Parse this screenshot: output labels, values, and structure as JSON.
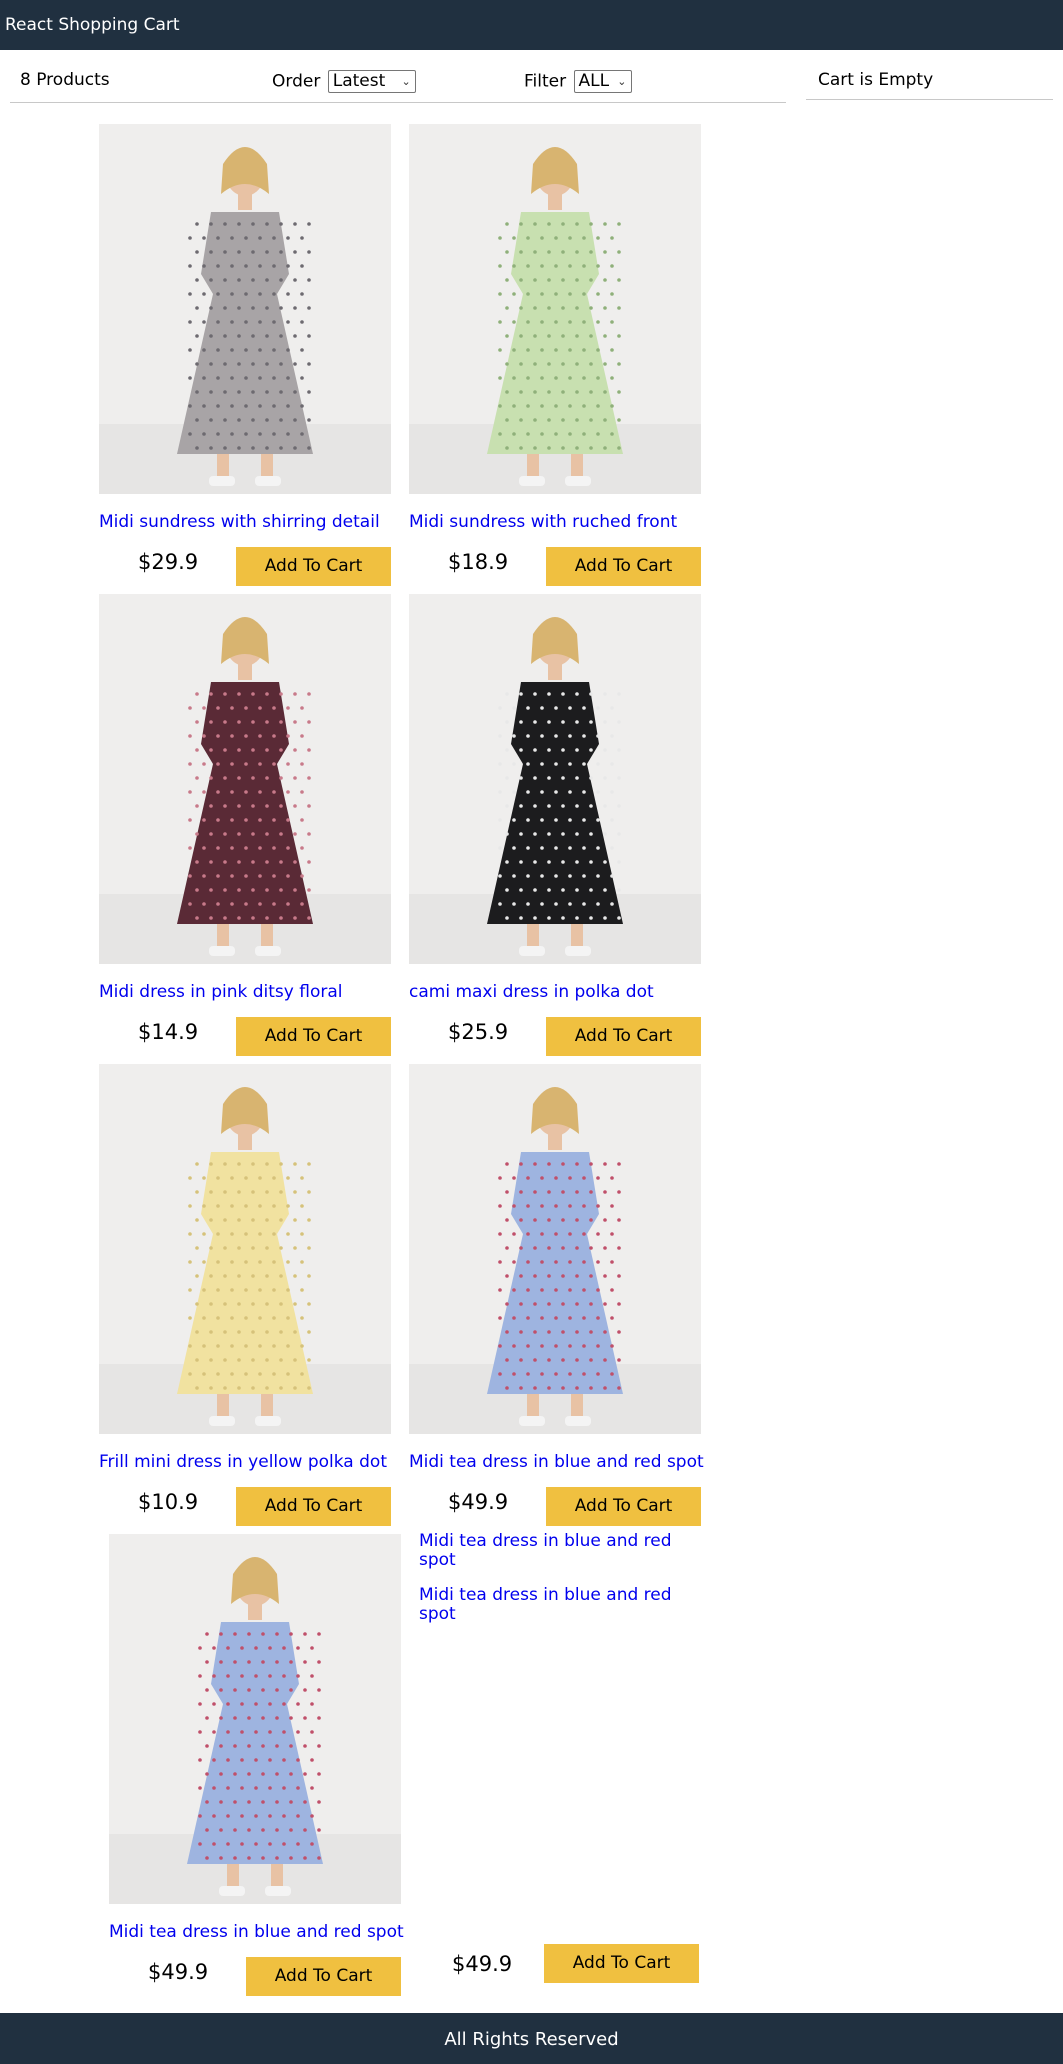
{
  "header": {
    "title": "React Shopping Cart"
  },
  "filter": {
    "count": "8 Products",
    "order_label": "Order",
    "order_value": "Latest",
    "filter_label": "Filter",
    "filter_value": "ALL"
  },
  "cart": {
    "empty_text": "Cart is Empty"
  },
  "products": [
    {
      "title": "Midi sundress with shirring detail",
      "price": "$29.9",
      "button": "Add To Cart",
      "dress_color": "#a8a4a6",
      "pattern": "#6d6a70"
    },
    {
      "title": "Midi sundress with ruched front",
      "price": "$18.9",
      "button": "Add To Cart",
      "dress_color": "#c8e0b0",
      "pattern": "#8fb07a"
    },
    {
      "title": "Midi dress in pink ditsy floral",
      "price": "$14.9",
      "button": "Add To Cart",
      "dress_color": "#5a2a36",
      "pattern": "#c87a8a"
    },
    {
      "title": "cami maxi dress in polka dot",
      "price": "$25.9",
      "button": "Add To Cart",
      "dress_color": "#1c1c1e",
      "pattern": "#e8e8e8"
    },
    {
      "title": "Frill mini dress in yellow polka dot",
      "price": "$10.9",
      "button": "Add To Cart",
      "dress_color": "#f1e2a0",
      "pattern": "#d6c27a"
    },
    {
      "title": "Midi tea dress in blue and red spot",
      "price": "$49.9",
      "button": "Add To Cart",
      "dress_color": "#9eb4e0",
      "pattern": "#c0506a"
    },
    {
      "title": "Midi tea dress in blue and red spot",
      "price": "$49.9",
      "button": "Add To Cart",
      "dress_color": "#9eb4e0",
      "pattern": "#c0506a"
    }
  ],
  "extra_links": [
    "Midi tea dress in blue and red spot",
    "Midi tea dress in blue and red spot"
  ],
  "extra_item": {
    "price": "$49.9",
    "button": "Add To Cart"
  },
  "footer": {
    "text": "All Rights Reserved"
  },
  "colors": {
    "header_bg": "#203040",
    "button_bg": "#f0c040",
    "link": "#0000ee"
  }
}
